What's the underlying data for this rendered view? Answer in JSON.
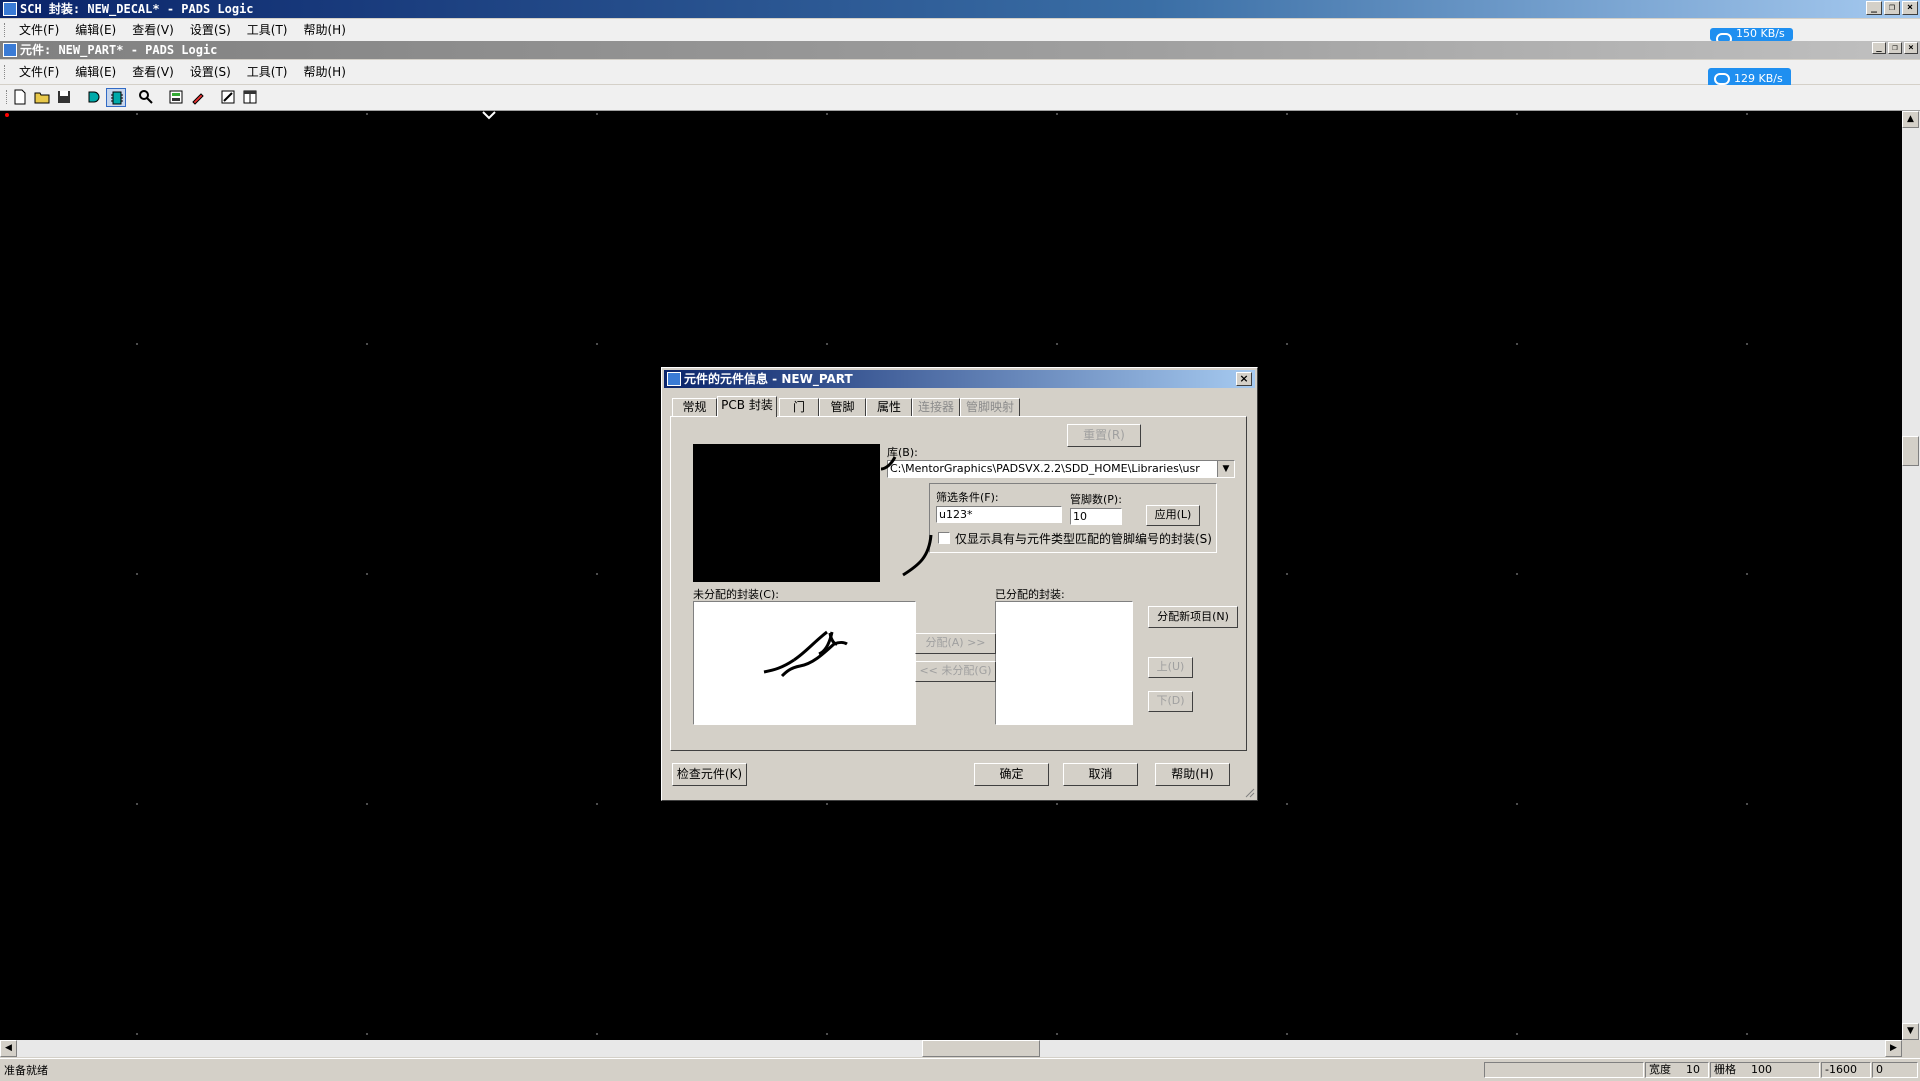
{
  "outer_window": {
    "title": "SCH 封装: NEW_DECAL* - PADS Logic",
    "menu": [
      "文件(F)",
      "编辑(E)",
      "查看(V)",
      "设置(S)",
      "工具(T)",
      "帮助(H)"
    ],
    "net_speed": "150 KB/s"
  },
  "inner_window": {
    "title": "元件: NEW_PART* - PADS Logic",
    "menu": [
      "文件(F)",
      "编辑(E)",
      "查看(V)",
      "设置(S)",
      "工具(T)",
      "帮助(H)"
    ],
    "net_speed": "129 KB/s"
  },
  "toolbar": {
    "icons": [
      "new-file-icon",
      "open-folder-icon",
      "save-icon",
      "gate-icon",
      "decal-icon",
      "zoom-icon",
      "properties-icon",
      "paint-icon",
      "wizard-icon",
      "window-icon"
    ]
  },
  "dialog": {
    "title": "元件的元件信息 - NEW_PART",
    "close": "×",
    "tabs": [
      {
        "label": "常规",
        "enabled": true
      },
      {
        "label": "PCB 封装",
        "enabled": true,
        "selected": true
      },
      {
        "label": "门",
        "enabled": true
      },
      {
        "label": "管脚",
        "enabled": true
      },
      {
        "label": "属性",
        "enabled": true
      },
      {
        "label": "连接器",
        "enabled": false
      },
      {
        "label": "管脚映射",
        "enabled": false
      }
    ],
    "reset_label": "重置(R)",
    "library_label": "库(B):",
    "library_value": "C:\\MentorGraphics\\PADSVX.2.2\\SDD_HOME\\Libraries\\usr",
    "filter_label": "筛选条件(F):",
    "filter_value": "u123*",
    "pin_count_label": "管脚数(P):",
    "pin_count_value": "10",
    "apply_label": "应用(L)",
    "checkbox_label": "仅显示具有与元件类型匹配的管脚编号的封装(S)",
    "checkbox_checked": false,
    "unassigned_label": "未分配的封装(C):",
    "assigned_label": "已分配的封装:",
    "assign_label": "分配(A) >>",
    "unassign_label": "<< 未分配(G)",
    "assign_new_label": "分配新项目(N)",
    "up_label": "上(U)",
    "down_label": "下(D)",
    "check_part_label": "检查元件(K)",
    "ok_label": "确定",
    "cancel_label": "取消",
    "help_label": "帮助(H)"
  },
  "status": {
    "message": "准备就绪",
    "width_label": "宽度",
    "width_value": "10",
    "grid_label": "栅格",
    "grid_value": "100",
    "x_value": "-1600",
    "y_value": "0"
  }
}
